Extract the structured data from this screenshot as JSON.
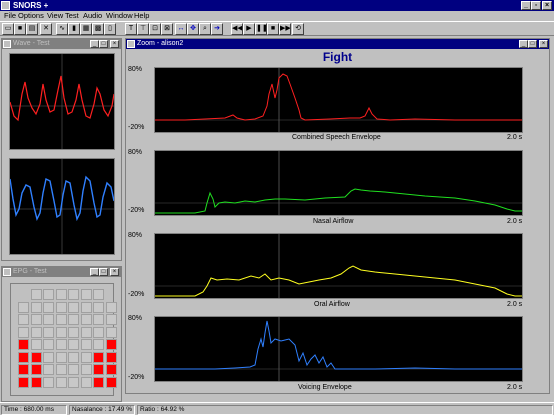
{
  "app": {
    "title": "SNORS +"
  },
  "menu": [
    "File",
    "Options",
    "View",
    "Test",
    "Audio",
    "Window",
    "Help"
  ],
  "wave_window": {
    "title": "Wave - Test"
  },
  "epg_window": {
    "title": "EPG - Test"
  },
  "zoom_window": {
    "title": "Zoom - alison2",
    "heading": "Fight"
  },
  "plots": [
    {
      "name": "Combined Speech Envelope",
      "ymax": "80%",
      "ymin": "-20%",
      "duration": "2.0 s",
      "color": "#ff2020"
    },
    {
      "name": "Nasal Airflow",
      "ymax": "80%",
      "ymin": "-20%",
      "duration": "2.0 s",
      "color": "#20e020"
    },
    {
      "name": "Oral Airflow",
      "ymax": "80%",
      "ymin": "-20%",
      "duration": "2.0 s",
      "color": "#ffff20"
    },
    {
      "name": "Voicing Envelope",
      "ymax": "80%",
      "ymin": "-20%",
      "duration": "2.0 s",
      "color": "#3080ff"
    }
  ],
  "status": {
    "time": "Time : 680.00 ms",
    "nasalance": "Nasalance : 17.49 %",
    "ratio": "Ratio : 64.92 %"
  },
  "colors": {
    "title_active": "#000080",
    "title_inactive": "#808080",
    "epg_on": "#ff0000",
    "epg_off": "#c8c8c8"
  }
}
